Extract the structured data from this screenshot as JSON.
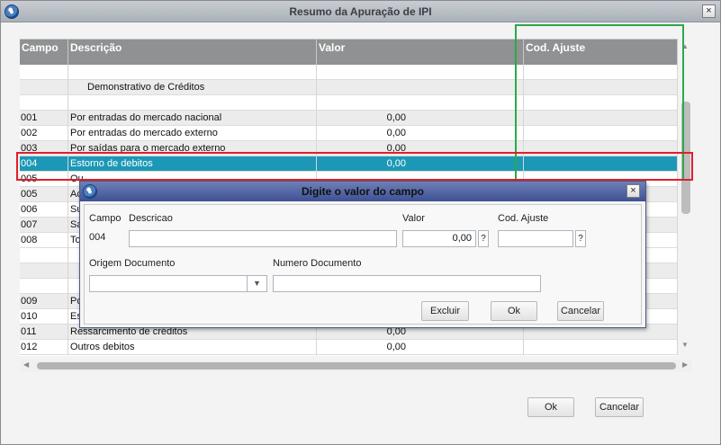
{
  "window": {
    "title": "Resumo da Apuração de IPI",
    "close_glyph": "×"
  },
  "grid": {
    "columns": [
      "Campo",
      "Descrição",
      "Valor",
      "Cod. Ajuste"
    ],
    "rows": [
      {
        "campo": "",
        "descricao": "",
        "valor": "",
        "cod": "",
        "style": "blank"
      },
      {
        "campo": "",
        "descricao": "Demonstrativo de Créditos",
        "valor": "",
        "cod": "",
        "style": "section"
      },
      {
        "campo": "",
        "descricao": "",
        "valor": "",
        "cod": "",
        "style": "blank"
      },
      {
        "campo": "001",
        "descricao": "Por entradas do mercado nacional",
        "valor": "0,00",
        "cod": "",
        "style": "band"
      },
      {
        "campo": "002",
        "descricao": "Por entradas do mercado externo",
        "valor": "0,00",
        "cod": "",
        "style": ""
      },
      {
        "campo": "003",
        "descricao": "Por saídas para o mercado externo",
        "valor": "0,00",
        "cod": "",
        "style": "band"
      },
      {
        "campo": "004",
        "descricao": "Estorno de debitos",
        "valor": "0,00",
        "cod": "",
        "style": "sel"
      },
      {
        "campo": "005",
        "descricao": "Ou",
        "valor": "",
        "cod": "",
        "style": ""
      },
      {
        "campo": "005",
        "descricao": "Ac",
        "valor": "",
        "cod": "",
        "style": "band"
      },
      {
        "campo": "006",
        "descricao": "Su",
        "valor": "",
        "cod": "",
        "style": ""
      },
      {
        "campo": "007",
        "descricao": "Sa",
        "valor": "",
        "cod": "",
        "style": "band"
      },
      {
        "campo": "008",
        "descricao": "To",
        "valor": "",
        "cod": "",
        "style": ""
      },
      {
        "campo": "",
        "descricao": "",
        "valor": "",
        "cod": "",
        "style": "blank"
      },
      {
        "campo": "",
        "descricao": "",
        "valor": "",
        "cod": "",
        "style": "section"
      },
      {
        "campo": "",
        "descricao": "",
        "valor": "",
        "cod": "",
        "style": "blank"
      },
      {
        "campo": "009",
        "descricao": "Po",
        "valor": "",
        "cod": "",
        "style": "band"
      },
      {
        "campo": "010",
        "descricao": "Es",
        "valor": "",
        "cod": "",
        "style": ""
      },
      {
        "campo": "011",
        "descricao": "Ressarcimento de créditos",
        "valor": "0,00",
        "cod": "",
        "style": "band"
      },
      {
        "campo": "012",
        "descricao": "Outros debitos",
        "valor": "0,00",
        "cod": "",
        "style": ""
      }
    ]
  },
  "scrollbars": {
    "up_arrow": "▲",
    "down_arrow": "▼",
    "left_arrow": "◀",
    "right_arrow": "▶"
  },
  "footer": {
    "ok_label": "Ok",
    "cancel_label": "Cancelar"
  },
  "dialog": {
    "title": "Digite o valor do campo",
    "close_glyph": "×",
    "campo_label": "Campo",
    "campo_value": "004",
    "descricao_label": "Descricao",
    "descricao_value": "",
    "valor_label": "Valor",
    "valor_value": "0,00",
    "cod_ajuste_label": "Cod. Ajuste",
    "cod_ajuste_value": "",
    "lookup_glyph": "?",
    "origem_label": "Origem Documento",
    "origem_value": "",
    "dropdown_glyph": "▼",
    "numero_label": "Numero Documento",
    "numero_value": "",
    "excluir_label": "Excluir",
    "ok_label": "Ok",
    "cancel_label": "Cancelar"
  },
  "colors": {
    "header_bg": "#8f9193",
    "selected_row": "#1c98b6",
    "highlight_red": "#e01f2b",
    "highlight_green": "#2aa94a",
    "dialog_title": "#3e5194"
  }
}
